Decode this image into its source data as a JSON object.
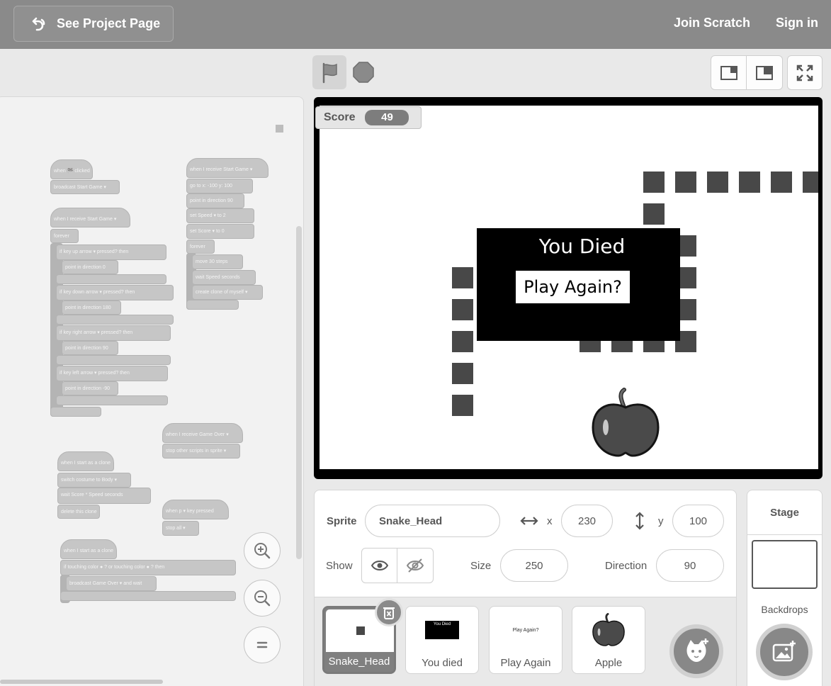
{
  "menu": {
    "project_page": "See Project Page",
    "join": "Join Scratch",
    "sign_in": "Sign in"
  },
  "stage": {
    "score_label": "Score",
    "score_value": "49",
    "died_title": "You Died",
    "play_again": "Play Again?"
  },
  "sprite_info": {
    "sprite_label": "Sprite",
    "sprite_name": "Snake_Head",
    "x_label": "x",
    "x_value": "230",
    "y_label": "y",
    "y_value": "100",
    "show_label": "Show",
    "size_label": "Size",
    "size_value": "250",
    "direction_label": "Direction",
    "direction_value": "90"
  },
  "sprites": [
    {
      "name": "Snake_Head",
      "thumb_text": ""
    },
    {
      "name": "You died",
      "thumb_text": "You Died"
    },
    {
      "name": "Play Again",
      "thumb_text": "Play Again?"
    },
    {
      "name": "Apple",
      "thumb_text": ""
    }
  ],
  "stage_pane": {
    "title": "Stage",
    "backdrops": "Backdrops"
  },
  "blocks": {
    "b1": "when 🏁 clicked",
    "b2": "broadcast  Start Game ▾",
    "b3": "when I receive  Start Game ▾",
    "b4": "forever",
    "b5": "if   key  up arrow ▾  pressed?  then",
    "b6": "point in direction  0",
    "b7": "if   key  down arrow ▾  pressed?  then",
    "b8": "point in direction  180",
    "b9": "if   key  right arrow ▾  pressed?  then",
    "b10": "point in direction  90",
    "b11": "if   key  left arrow ▾  pressed?  then",
    "b12": "point in direction  -90",
    "b13": "when I receive  Start Game ▾",
    "b14": "go to x:  -100  y:  100",
    "b15": "point in direction  90",
    "b16": "set  Speed ▾  to  2",
    "b17": "set  Score ▾  to  0",
    "b18": "forever",
    "b19": "move  30  steps",
    "b20": "wait  Speed  seconds",
    "b21": "create clone of  myself ▾",
    "b22": "when I receive  Game Over ▾",
    "b23": "stop  other scripts in sprite ▾",
    "b24": "when I start as a clone",
    "b25": "switch costume to  Body ▾",
    "b26": "wait   Score  *  Speed   seconds",
    "b27": "delete this clone",
    "b28": "when  p ▾  key pressed",
    "b29": "stop  all ▾",
    "b30": "when I start as a clone",
    "b31": "if   touching color  ●  ?  or  touching color  ●  ?  then",
    "b32": "broadcast  Game Over ▾  and wait"
  },
  "icons": {
    "flag": "green-flag-icon",
    "stop": "stop-icon",
    "zoom_in": "zoom-in-icon",
    "zoom_out": "zoom-out-icon",
    "zoom_reset": "zoom-reset-icon"
  }
}
